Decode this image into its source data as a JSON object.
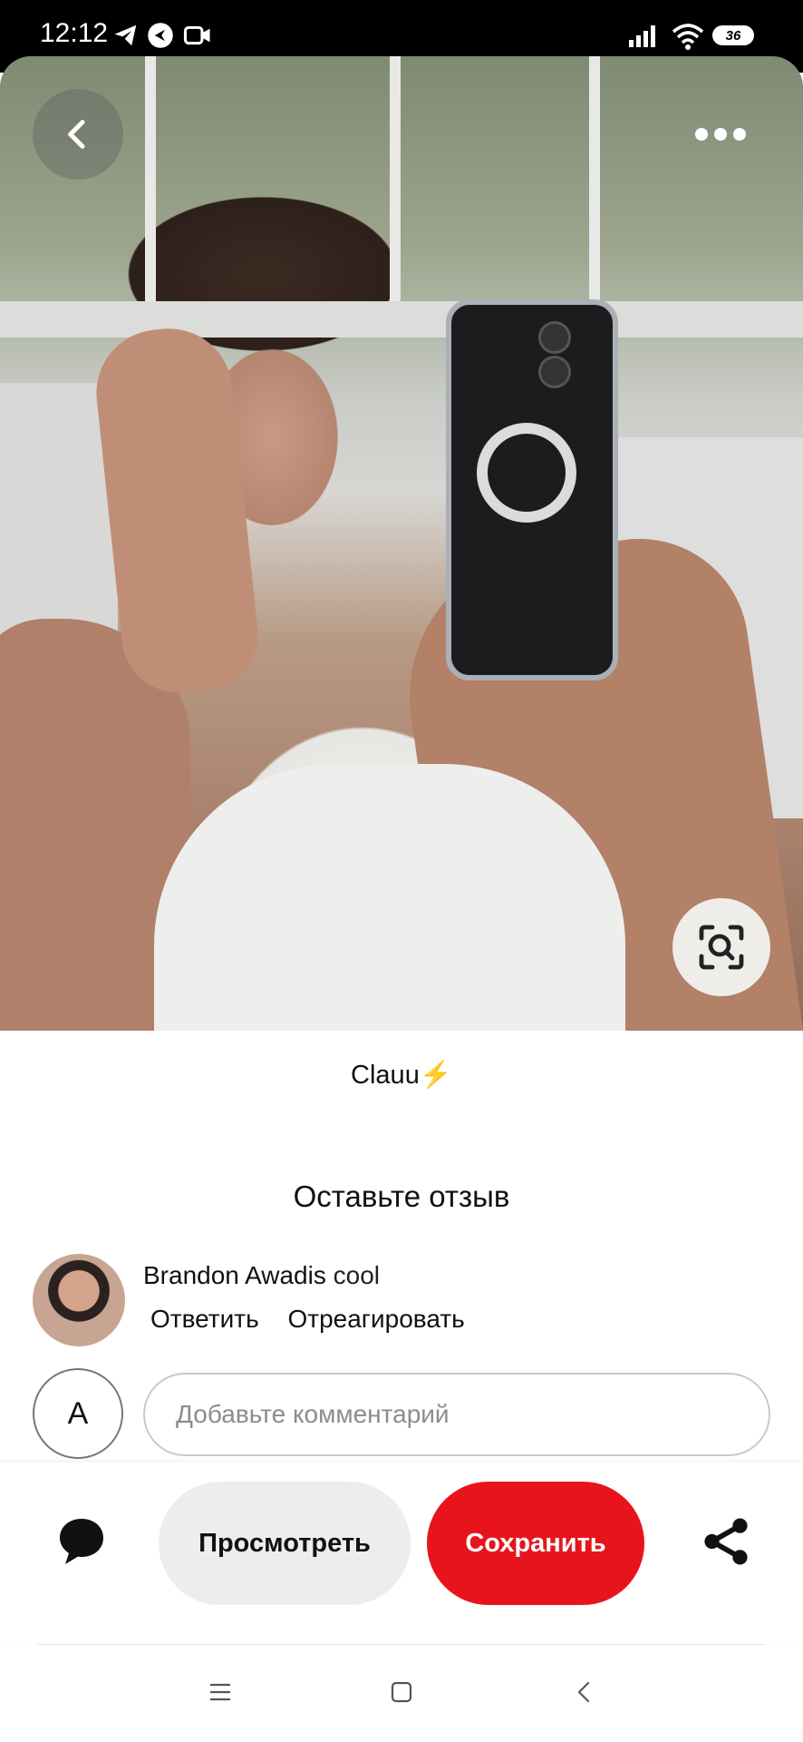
{
  "status_bar": {
    "time": "12:12",
    "battery": "36",
    "icons": [
      "telegram-icon",
      "app-notification-icon",
      "video-icon",
      "signal-icon",
      "wifi-icon",
      "battery-icon"
    ]
  },
  "pin": {
    "image_description_icon": "photo",
    "username": "Clauu",
    "username_emoji": "⚡"
  },
  "comments": {
    "title": "Оставьте отзыв",
    "items": [
      {
        "author": "Brandon Awadis",
        "text": "cool",
        "reply_label": "Ответить",
        "react_label": "Отреагировать"
      }
    ],
    "my_avatar_letter": "A",
    "input_placeholder": "Добавьте комментарий"
  },
  "actions": {
    "view_label": "Просмотреть",
    "save_label": "Сохранить"
  },
  "colors": {
    "save": "#e8141c",
    "view_bg": "#efedec"
  }
}
